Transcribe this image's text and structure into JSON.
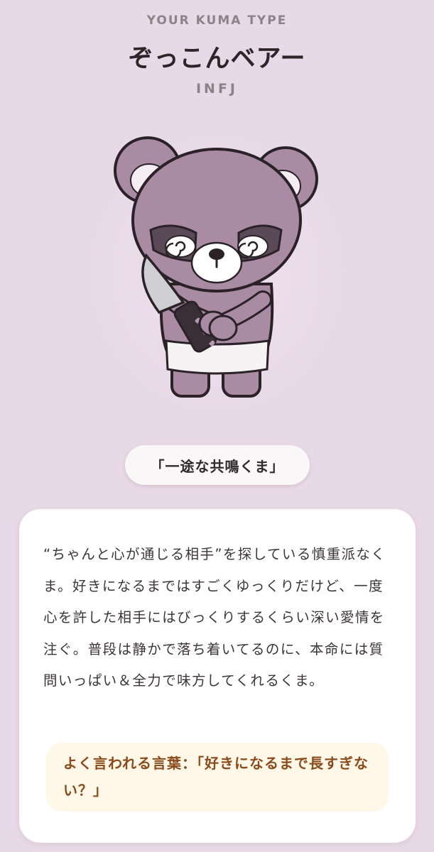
{
  "header": {
    "eyebrow": "YOUR KUMA TYPE",
    "title": "ぞっこんベアー",
    "code": "INFJ"
  },
  "illustration": {
    "name": "bear-with-knife-illustration",
    "colors": {
      "fur": "#a98ba3",
      "outline": "#2a2227",
      "muzzle": "#ffffff",
      "ear_inner": "#f4eef3",
      "eyelid": "#5a4a57",
      "blade": "#cfcfd3",
      "handle": "#3a2f36",
      "heart": "#b49ab0"
    }
  },
  "tagline": "「一途な共鳴くま」",
  "description": "“ちゃんと心が通じる相手”を探している慎重派なくま。好きになるまではすごくゆっくりだけど、一度心を許した相手にはびっくりするくらい深い愛情を注ぐ。普段は静かで落ち着いてるのに、本命には質問いっぱい＆全力で味方してくれるくま。",
  "saying": "よく言われる言葉：「好きになるまで長すぎない？」",
  "colors": {
    "background": "#e8d9e6",
    "card": "#ffffff",
    "quote_bg": "#fff7e7",
    "quote_text": "#8a4a1a",
    "muted_text": "#8e8288"
  }
}
